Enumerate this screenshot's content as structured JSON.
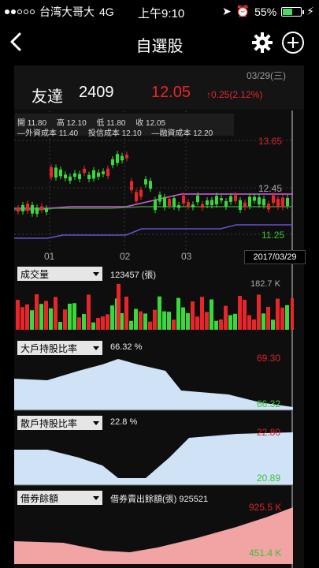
{
  "status_bar": {
    "carrier": "台湾大哥大",
    "network": "4G",
    "time": "上午9:10",
    "battery": "55%",
    "battery_level": 0.55
  },
  "nav": {
    "title": "自選股"
  },
  "quote": {
    "name": "友達",
    "code": "2409",
    "price": "12.05",
    "change": "0.25(2.12%)",
    "date": "03/29(三)"
  },
  "ohlc": {
    "open": "開 11.80",
    "high": "高 12.10",
    "low": "低 11.80",
    "close": "收 12.05"
  },
  "cost": {
    "foreign": "—外資成本 11.40",
    "trust": "投信成本 12.10",
    "margin": "—融資成本 12.20"
  },
  "price_axis": {
    "top": "13.65",
    "mid": "12.45",
    "bottom": "11.25"
  },
  "x_axis": [
    "01",
    "02",
    "03"
  ],
  "cursor_date": "2017/03/29",
  "panels": {
    "volume": {
      "label": "成交量",
      "info": "123457 (張)",
      "max": "182.7 K"
    },
    "big_holder": {
      "label": "大戶持股比率",
      "info": "66.32 %",
      "top": "69.30",
      "bottom": "66.32"
    },
    "retail": {
      "label": "散戶持股比率",
      "info": "22.8 %",
      "top": "22.80",
      "bottom": "20.89"
    },
    "short": {
      "label": "借券餘額",
      "info": "借券賣出餘額(張) 925521",
      "top": "925.5 K",
      "bottom": "451.4 K"
    }
  },
  "colors": {
    "up": "#e8262a",
    "down": "#39d93b",
    "trust_line": "#d55be0",
    "foreign_line": "#3c8b3c",
    "margin_line": "#6a4fd2",
    "area_blue": "#cfe2f6",
    "area_pink": "#f2a3a3"
  },
  "chart_data": {
    "type": "candlestick",
    "x": [
      "01",
      "02",
      "03"
    ],
    "price_range": [
      11.25,
      13.65
    ],
    "last_close": 12.05,
    "volume_max": "182.7 K"
  }
}
